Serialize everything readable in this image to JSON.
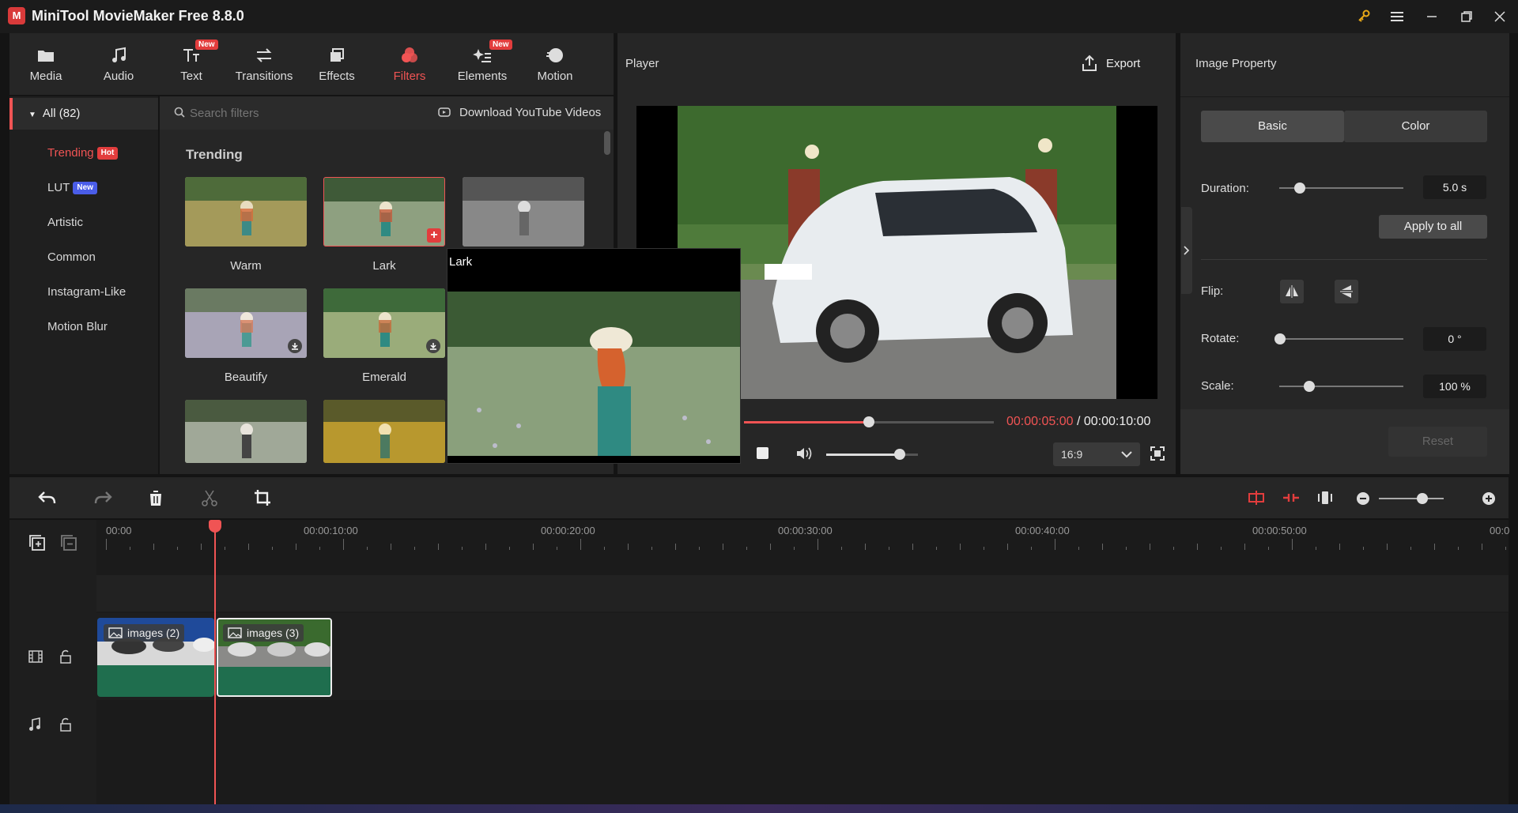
{
  "app": {
    "title": "MiniTool MovieMaker Free 8.8.0",
    "logo": "M"
  },
  "toolbar": {
    "items": [
      {
        "label": "Media",
        "icon": "folder-icon"
      },
      {
        "label": "Audio",
        "icon": "music-note-icon"
      },
      {
        "label": "Text",
        "icon": "text-icon",
        "tag": "New"
      },
      {
        "label": "Transitions",
        "icon": "swap-arrows-icon"
      },
      {
        "label": "Effects",
        "icon": "layers-icon"
      },
      {
        "label": "Filters",
        "icon": "filters-icon",
        "active": true
      },
      {
        "label": "Elements",
        "icon": "sparkle-list-icon",
        "tag": "New"
      },
      {
        "label": "Motion",
        "icon": "motion-ball-icon"
      }
    ]
  },
  "categories": {
    "all": "All (82)",
    "items": [
      {
        "label": "Trending",
        "badge": "Hot",
        "badge_color": "#e23d3d"
      },
      {
        "label": "LUT",
        "badge": "New",
        "badge_color": "#4a5de8"
      },
      {
        "label": "Artistic"
      },
      {
        "label": "Common"
      },
      {
        "label": "Instagram-Like"
      },
      {
        "label": "Motion Blur"
      }
    ]
  },
  "filters": {
    "search_placeholder": "Search filters",
    "download_label": "Download YouTube Videos",
    "section_title": "Trending",
    "items": [
      {
        "label": "Warm"
      },
      {
        "label": "Lark"
      },
      {
        "label": ""
      },
      {
        "label": "Beautify"
      },
      {
        "label": "Emerald"
      }
    ],
    "preview_title": "Lark"
  },
  "player": {
    "title": "Player",
    "export_label": "Export",
    "current_time": "00:00:05:00",
    "separator": " / ",
    "total_time": "00:00:10:00",
    "aspect": "16:9",
    "progress": 0.5,
    "volume": 0.8
  },
  "properties": {
    "title": "Image Property",
    "tab_basic": "Basic",
    "tab_color": "Color",
    "duration_label": "Duration:",
    "duration_value": "5.0 s",
    "apply_all": "Apply to all",
    "flip_label": "Flip:",
    "rotate_label": "Rotate:",
    "rotate_value": "0 °",
    "scale_label": "Scale:",
    "scale_value": "100 %",
    "reset": "Reset"
  },
  "timeline": {
    "ruler": [
      "00:00",
      "00:00:10:00",
      "00:00:20:00",
      "00:00:30:00",
      "00:00:40:00",
      "00:00:50:00",
      "00:0"
    ],
    "clips": [
      {
        "label": "images (2)"
      },
      {
        "label": "images (3)"
      }
    ]
  },
  "colors": {
    "accent": "#f05454",
    "clip_green": "#1f6e4e"
  }
}
